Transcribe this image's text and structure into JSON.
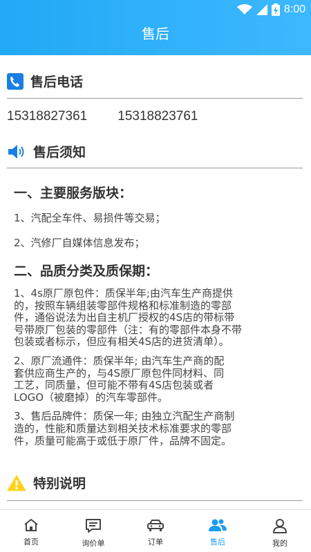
{
  "status_bar": {
    "time": "8:00"
  },
  "header": {
    "title": "售后"
  },
  "phone_section": {
    "title": "售后电话",
    "numbers": [
      "15318827361",
      "15318823761"
    ]
  },
  "notice_section": {
    "title": "售后须知",
    "main_title": "一、主要服务版块：",
    "main_items": [
      "1、汽配全车件、易损件等交易；",
      "2、汽修厂自媒体信息发布；"
    ],
    "quality_title": "二、品质分类及质保期：",
    "quality_lines_1": [
      "1、4s原厂原包件：质保半年;由汽车生产商提供",
      "的，按照车辆组装零部件规格和标准制造的零部",
      "件，通俗说法为出自主机厂授权的4S店的带标带",
      "号带原厂包装的零部件（注：有的零部件本身不带",
      "包装或者标示，但应有相关4S店的进货清单）。"
    ],
    "quality_lines_2": [
      "2、原厂流通件：质保半年; 由汽车生产商的配",
      "套供应商生产的，与4S原厂原包件同材料、同",
      "工艺，同质量，但可能不带有4S店包装或者",
      "LOGO（被磨掉）的汽车零部件。"
    ],
    "quality_lines_3": [
      "3、售后品牌件：质保一年; 由独立汽配生产商制",
      "造的，性能和质量达到相关技术标准要求的零部",
      "件，质量可能高于或低于原厂件，品牌不固定。"
    ]
  },
  "special_section": {
    "title": "特别说明"
  },
  "tabbar": {
    "items": [
      {
        "label": "首页",
        "icon": "home-icon"
      },
      {
        "label": "询价单",
        "icon": "inquiry-icon"
      },
      {
        "label": "订单",
        "icon": "order-icon"
      },
      {
        "label": "售后",
        "icon": "users-icon",
        "active": true
      },
      {
        "label": "我的",
        "icon": "profile-icon"
      }
    ],
    "active_color": "#1a9cf3"
  },
  "colors": {
    "header": "#22a9f5",
    "accent": "#1a9cf3",
    "warning": "#ffd21a"
  }
}
